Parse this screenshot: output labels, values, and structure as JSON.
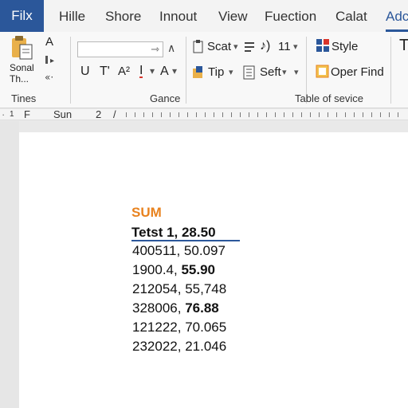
{
  "tabs": {
    "file": "Filx",
    "items": [
      "Hille",
      "Shore",
      "Innout",
      "View",
      "Fuection",
      "Calat",
      "Adc"
    ]
  },
  "ribbon": {
    "paste_top": "Sonal",
    "paste_bottom": "Th...",
    "small_a": "A",
    "group1_label": "Tines",
    "group2_label": "Gance",
    "group3_label": "Table of sevice",
    "format_u": "U",
    "format_t": "T'",
    "format_a2": "A²",
    "format_i": "I",
    "format_a": "A",
    "scat": "Scat",
    "number_val": "11",
    "tip": "Tip",
    "seft": "Seft",
    "style": "Style",
    "oper_find": "Oper Find",
    "far_right": "T"
  },
  "ruler": {
    "left_mark": "1",
    "f_label": "F",
    "sun_label": "Sun",
    "num_label": "2"
  },
  "document": {
    "heading": "SUM",
    "header_row": "Tetst 1, 28.50",
    "rows": [
      {
        "a": "400511,",
        "b": "50.097",
        "bold": false
      },
      {
        "a": "1900.4,",
        "b": "55.90",
        "bold": true
      },
      {
        "a": "212054,",
        "b": "55,748",
        "bold": false
      },
      {
        "a": "328006,",
        "b": "76.88",
        "bold": true
      },
      {
        "a": "121222,",
        "b": "70.065",
        "bold": false
      },
      {
        "a": "232022,",
        "b": "21.046",
        "bold": false
      }
    ]
  },
  "colors": {
    "accent": "#2b579a",
    "heading": "#e8821e"
  }
}
